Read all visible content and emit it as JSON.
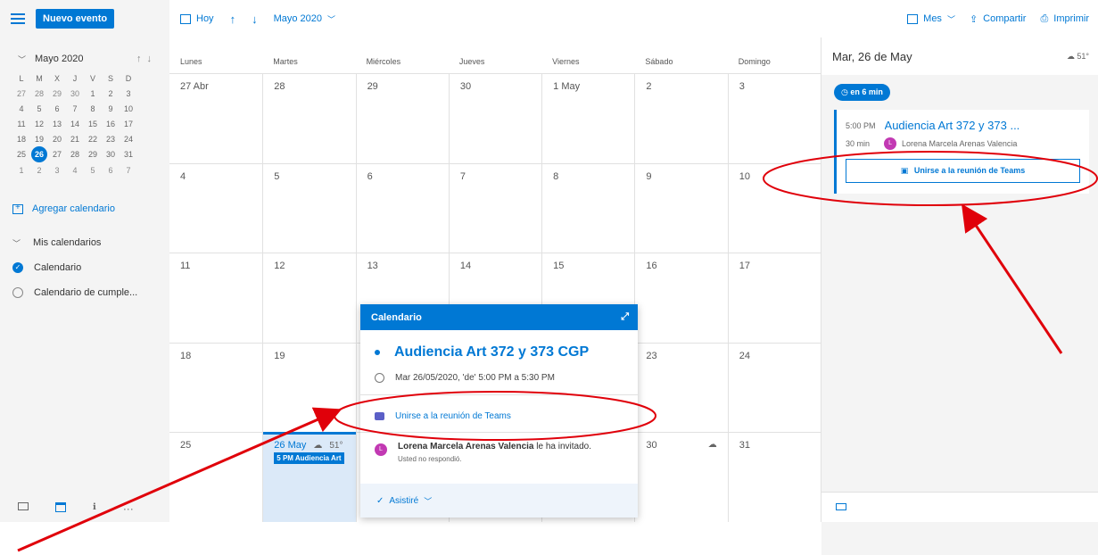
{
  "toolbar": {
    "new_event": "Nuevo evento",
    "today": "Hoy",
    "month_label": "Mayo 2020",
    "view": "Mes",
    "share": "Compartir",
    "print": "Imprimir"
  },
  "mini_calendar": {
    "title": "Mayo 2020",
    "weekdays": [
      "L",
      "M",
      "X",
      "J",
      "V",
      "S",
      "D"
    ],
    "weeks": [
      [
        "27",
        "28",
        "29",
        "30",
        "1",
        "2",
        "3"
      ],
      [
        "4",
        "5",
        "6",
        "7",
        "8",
        "9",
        "10"
      ],
      [
        "11",
        "12",
        "13",
        "14",
        "15",
        "16",
        "17"
      ],
      [
        "18",
        "19",
        "20",
        "21",
        "22",
        "23",
        "24"
      ],
      [
        "25",
        "26",
        "27",
        "28",
        "29",
        "30",
        "31"
      ],
      [
        "1",
        "2",
        "3",
        "4",
        "5",
        "6",
        "7"
      ]
    ],
    "today": "26"
  },
  "sidebar": {
    "add_calendar": "Agregar calendario",
    "my_calendars": "Mis calendarios",
    "calendars": [
      "Calendario",
      "Calendario de cumple..."
    ]
  },
  "grid": {
    "weekdays": [
      "Lunes",
      "Martes",
      "Miércoles",
      "Jueves",
      "Viernes",
      "Sábado",
      "Domingo"
    ],
    "weeks": [
      [
        "27 Abr",
        "28",
        "29",
        "30",
        "1 May",
        "2",
        "3"
      ],
      [
        "4",
        "5",
        "6",
        "7",
        "8",
        "9",
        "10"
      ],
      [
        "11",
        "12",
        "13",
        "14",
        "15",
        "16",
        "17"
      ],
      [
        "18",
        "19",
        "",
        "",
        "",
        "23",
        "24"
      ],
      [
        "25",
        "26 May",
        "",
        "",
        "",
        "30",
        "31"
      ]
    ],
    "selected_weather": "51°",
    "selected_event": "5 PM Audiencia Art"
  },
  "right_pane": {
    "date": "Mar, 26 de May",
    "weather": "51°",
    "countdown": "en 6 min",
    "event_time": "5:00 PM",
    "event_title": "Audiencia Art 372 y 373 ...",
    "duration": "30 min",
    "organizer": "Lorena Marcela Arenas Valencia",
    "avatar_initial": "L",
    "teams_button": "Unirse a la reunión de Teams"
  },
  "popup": {
    "header": "Calendario",
    "title": "Audiencia Art 372 y 373 CGP",
    "time": "Mar 26/05/2020, 'de' 5:00 PM a 5:30 PM",
    "teams_link": "Unirse a la reunión de Teams",
    "inviter_name": "Lorena Marcela Arenas Valencia",
    "invite_suffix": " le ha invitado.",
    "response_status": "Usted no respondió.",
    "rsvp": "Asistiré",
    "avatar_initial": "L"
  },
  "colors": {
    "accent": "#0078d4",
    "annotation": "#e0000a",
    "avatar": "#c239b3"
  }
}
